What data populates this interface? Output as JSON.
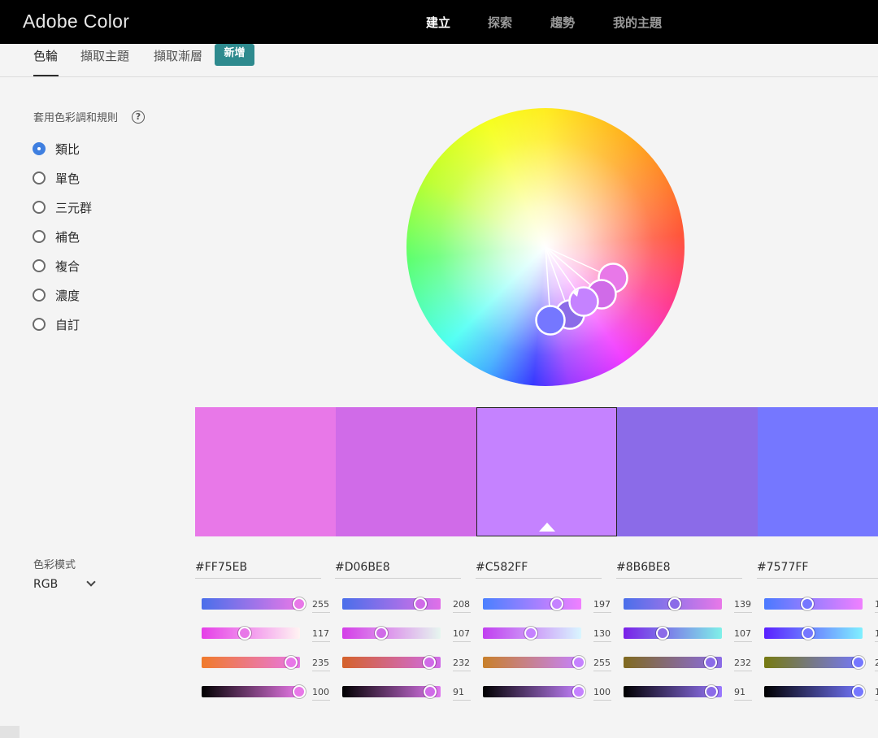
{
  "brand": "Adobe Color",
  "top_nav": [
    {
      "label": "建立",
      "active": true
    },
    {
      "label": "探索",
      "active": false
    },
    {
      "label": "趨勢",
      "active": false
    },
    {
      "label": "我的主題",
      "active": false
    }
  ],
  "sub_tabs": [
    {
      "label": "色輪",
      "active": true
    },
    {
      "label": "擷取主題",
      "active": false
    },
    {
      "label": "擷取漸層",
      "active": false
    }
  ],
  "badge": "新增",
  "rules": {
    "title": "套用色彩調和規則",
    "help_icon": "question-circle-icon",
    "options": [
      {
        "label": "類比",
        "checked": true
      },
      {
        "label": "單色",
        "checked": false
      },
      {
        "label": "三元群",
        "checked": false
      },
      {
        "label": "補色",
        "checked": false
      },
      {
        "label": "複合",
        "checked": false
      },
      {
        "label": "濃度",
        "checked": false
      },
      {
        "label": "自訂",
        "checked": false
      }
    ]
  },
  "color_mode": {
    "label": "色彩模式",
    "value": "RGB",
    "icon": "chevron-down-icon"
  },
  "swatches": [
    {
      "hex": "#FF75EB",
      "color": "#e878e8",
      "selected": false,
      "r": "255",
      "g": "117",
      "b": "235",
      "a": "100"
    },
    {
      "hex": "#D06BE8",
      "color": "#d06be8",
      "selected": false,
      "r": "208",
      "g": "107",
      "b": "232",
      "a": "91"
    },
    {
      "hex": "#C582FF",
      "color": "#c582ff",
      "selected": true,
      "r": "197",
      "g": "130",
      "b": "255",
      "a": "100"
    },
    {
      "hex": "#8B6BE8",
      "color": "#8b6be8",
      "selected": false,
      "r": "139",
      "g": "107",
      "b": "232",
      "a": "91"
    },
    {
      "hex": "#7577FF",
      "color": "#7577ff",
      "selected": false,
      "r": "1",
      "g": "1",
      "b": "2",
      "a": "1"
    }
  ]
}
